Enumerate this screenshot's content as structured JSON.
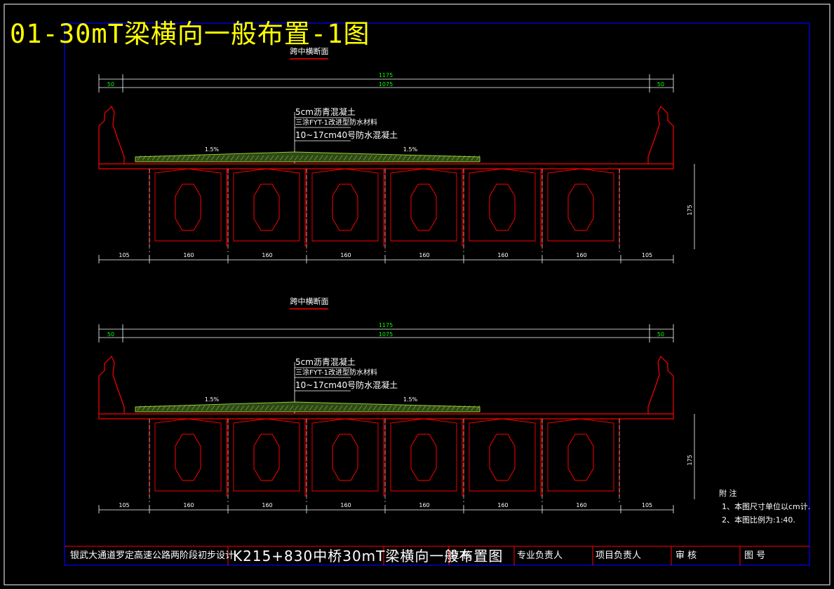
{
  "page_title": "01-30mT梁横向一般布置-1图",
  "sections": [
    {
      "title": "跨中横断面",
      "dims": {
        "total": "1175",
        "inner": "1075",
        "left": "50",
        "right": "50",
        "bottom": [
          "105",
          "160",
          "160",
          "160",
          "160",
          "160",
          "160",
          "105"
        ],
        "height": "175"
      },
      "layers": [
        "5cm沥青混凝土",
        "三涂FYT-1改进型防水材料",
        "10~17cm40号防水混凝土"
      ],
      "slopes": [
        "1.5%",
        "1.5%"
      ]
    },
    {
      "title": "跨中横断面",
      "dims": {
        "total": "1175",
        "inner": "1075",
        "left": "50",
        "right": "50",
        "bottom": [
          "105",
          "160",
          "160",
          "160",
          "160",
          "160",
          "160",
          "105"
        ],
        "height": "175"
      },
      "layers": [
        "5cm沥青混凝土",
        "三涂FYT-1改进型防水材料",
        "10~17cm40号防水混凝土"
      ],
      "slopes": [
        "1.5%",
        "1.5%"
      ]
    }
  ],
  "notes": {
    "heading": "附 注",
    "items": [
      "1、本图尺寸单位以cm计.",
      "2、本图比例为:1:40."
    ]
  },
  "title_block": {
    "project": "银武大通道罗定高速公路两阶段初步设计",
    "drawing": "K215+830中桥30mT梁横向一般布置图",
    "review": "复  核",
    "specialist": "专业负责人",
    "project_lead": "项目负责人",
    "approve": "审  核",
    "sheet": "图  号"
  },
  "colors": {
    "background": "#000000",
    "frame": "#0000ff",
    "structure": "#ff0000",
    "dimension": "#00ff00",
    "pavement": "#9acd32",
    "title": "#ffff00",
    "text": "#ffffff"
  }
}
